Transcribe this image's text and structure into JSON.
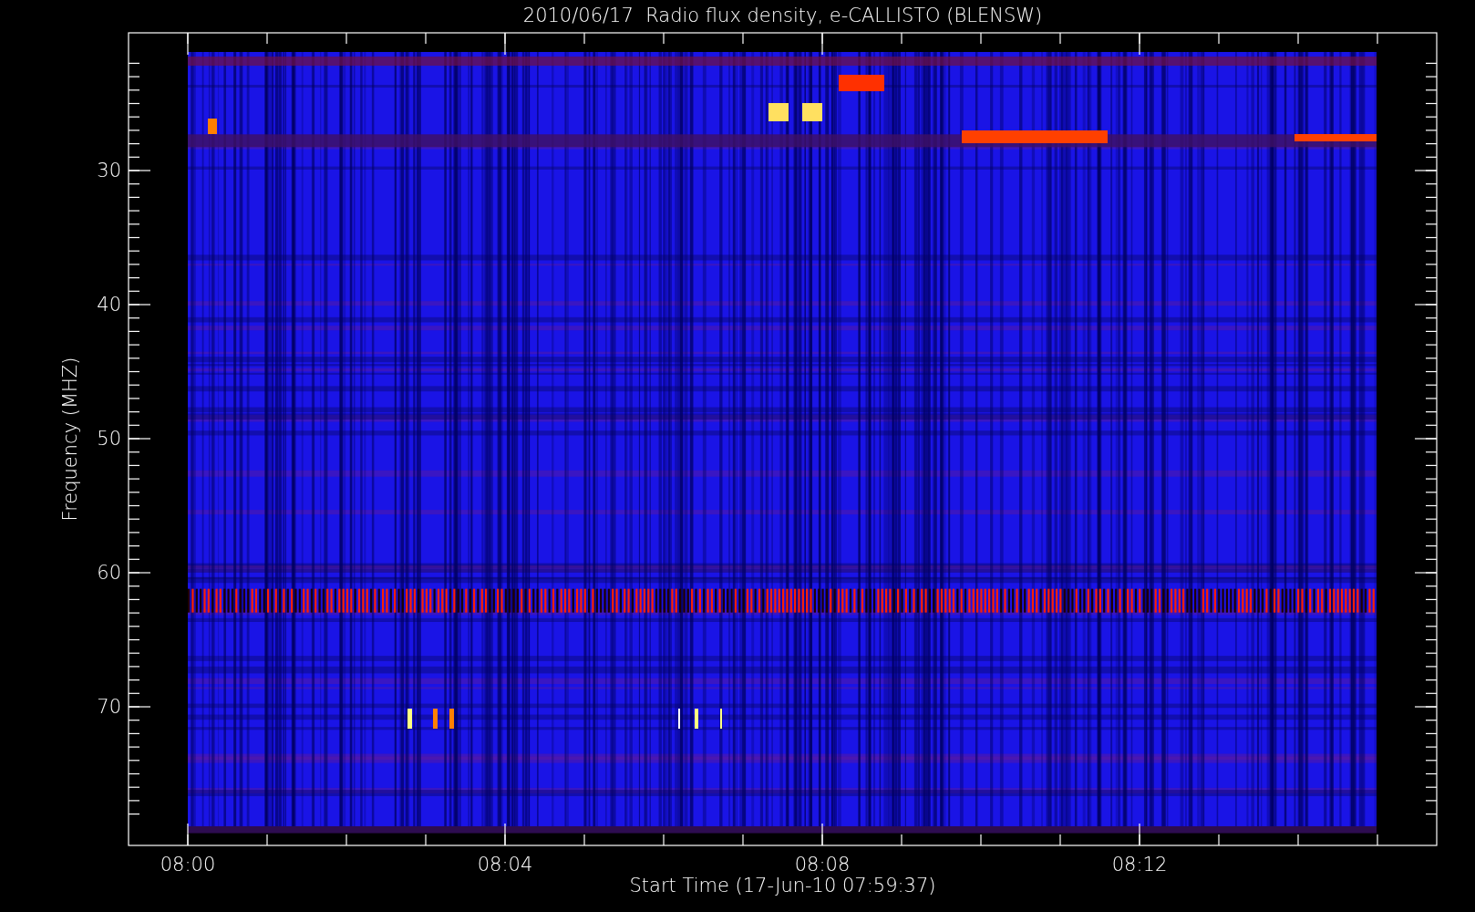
{
  "plot": {
    "title": "2010/06/17  Radio flux density, e-CALLISTO (BLENSW)",
    "xlabel": "Start Time (17-Jun-10 07:59:37)",
    "ylabel": "Frequency (MHZ)",
    "x_tick_labels": [
      "08:00",
      "08:04",
      "08:08",
      "08:12"
    ],
    "y_tick_labels": [
      "30",
      "40",
      "50",
      "60",
      "70"
    ]
  }
}
